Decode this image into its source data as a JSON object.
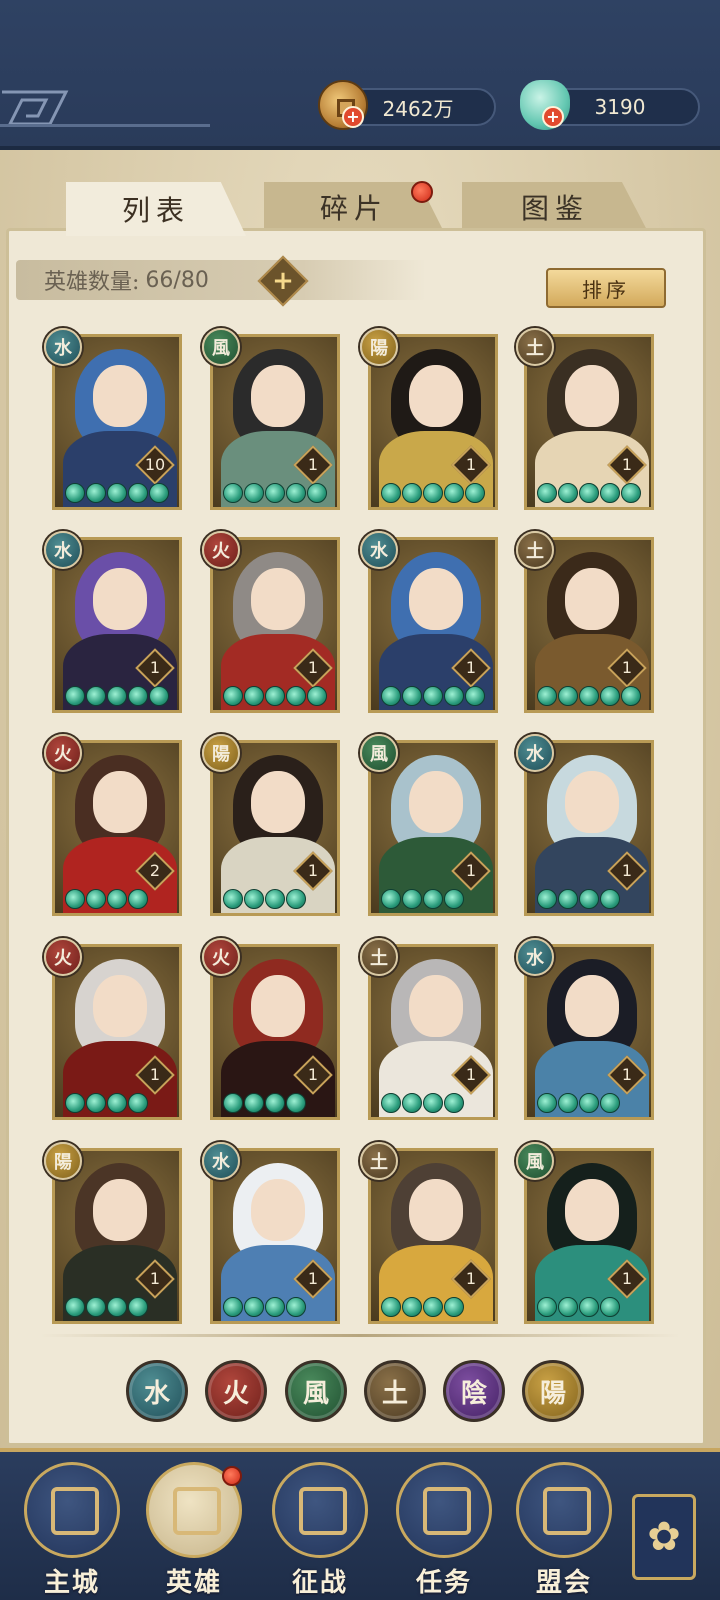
{
  "resources": {
    "coins": "2462万",
    "jade": "3190"
  },
  "tabs": [
    {
      "label": "列表",
      "active": true
    },
    {
      "label": "碎片",
      "active": false,
      "notify": true
    },
    {
      "label": "图鉴",
      "active": false
    }
  ],
  "hero_count": {
    "label": "英雄数量:",
    "value": "66/80"
  },
  "sort_label": "排序",
  "elements": {
    "water": {
      "glyph": "水",
      "color": "#1f4e58"
    },
    "fire": {
      "glyph": "火",
      "color": "#6d1f1a"
    },
    "wind": {
      "glyph": "風",
      "color": "#1f4f30"
    },
    "earth": {
      "glyph": "土",
      "color": "#4b3a22"
    },
    "yin": {
      "glyph": "陰",
      "color": "#432063"
    },
    "yang": {
      "glyph": "陽",
      "color": "#80611b"
    }
  },
  "heroes": [
    {
      "element": "water",
      "glyph": "水",
      "level": "10",
      "stars": 5
    },
    {
      "element": "wind",
      "glyph": "風",
      "level": "1",
      "stars": 5
    },
    {
      "element": "yang",
      "glyph": "陽",
      "level": "1",
      "stars": 5
    },
    {
      "element": "earth",
      "glyph": "土",
      "level": "1",
      "stars": 5
    },
    {
      "element": "water",
      "glyph": "水",
      "level": "1",
      "stars": 5
    },
    {
      "element": "fire",
      "glyph": "火",
      "level": "1",
      "stars": 5
    },
    {
      "element": "water",
      "glyph": "水",
      "level": "1",
      "stars": 5
    },
    {
      "element": "earth",
      "glyph": "土",
      "level": "1",
      "stars": 5
    },
    {
      "element": "fire",
      "glyph": "火",
      "level": "2",
      "stars": 4
    },
    {
      "element": "yang",
      "glyph": "陽",
      "level": "1",
      "stars": 4
    },
    {
      "element": "wind",
      "glyph": "風",
      "level": "1",
      "stars": 4
    },
    {
      "element": "water",
      "glyph": "水",
      "level": "1",
      "stars": 4
    },
    {
      "element": "fire",
      "glyph": "火",
      "level": "1",
      "stars": 4
    },
    {
      "element": "fire",
      "glyph": "火",
      "level": "1",
      "stars": 4
    },
    {
      "element": "earth",
      "glyph": "土",
      "level": "1",
      "stars": 4
    },
    {
      "element": "water",
      "glyph": "水",
      "level": "1",
      "stars": 4
    },
    {
      "element": "yang",
      "glyph": "陽",
      "level": "1",
      "stars": 4
    },
    {
      "element": "water",
      "glyph": "水",
      "level": "1",
      "stars": 4
    },
    {
      "element": "earth",
      "glyph": "土",
      "level": "1",
      "stars": 4
    },
    {
      "element": "wind",
      "glyph": "風",
      "level": "1",
      "stars": 4
    }
  ],
  "filters": [
    {
      "element": "water",
      "glyph": "水"
    },
    {
      "element": "fire",
      "glyph": "火"
    },
    {
      "element": "wind",
      "glyph": "風"
    },
    {
      "element": "earth",
      "glyph": "土"
    },
    {
      "element": "yin",
      "glyph": "陰"
    },
    {
      "element": "yang",
      "glyph": "陽"
    }
  ],
  "nav": [
    {
      "label": "主城",
      "icon": "city-icon"
    },
    {
      "label": "英雄",
      "icon": "hero-icon",
      "active": true,
      "notify": true
    },
    {
      "label": "征战",
      "icon": "battle-icon"
    },
    {
      "label": "任务",
      "icon": "quest-icon"
    },
    {
      "label": "盟会",
      "icon": "guild-icon"
    }
  ],
  "more_icon": "flower-menu-icon"
}
